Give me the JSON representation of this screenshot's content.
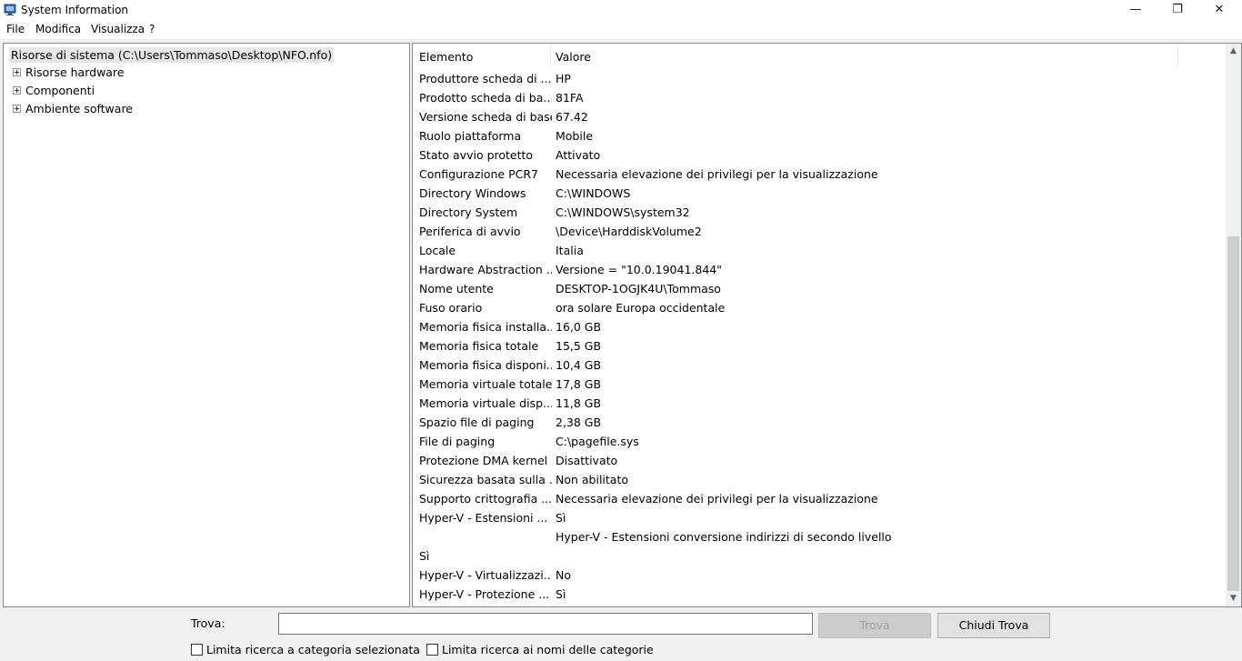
{
  "window": {
    "title": "System Information",
    "minimize_glyph": "—",
    "maximize_glyph": "❐",
    "close_glyph": "✕"
  },
  "menu": [
    "File",
    "Modifica",
    "Visualizza",
    "?"
  ],
  "tree": {
    "root": "Risorse di sistema (C:\\Users\\Tommaso\\Desktop\\NFO.nfo)",
    "items": [
      "Risorse hardware",
      "Componenti",
      "Ambiente software"
    ]
  },
  "table": {
    "headers": [
      "Elemento",
      "Valore"
    ],
    "rows": [
      {
        "e": "Produttore scheda di ...",
        "v": "HP"
      },
      {
        "e": "Prodotto scheda di ba...",
        "v": "81FA"
      },
      {
        "e": "Versione scheda di base",
        "v": "67.42"
      },
      {
        "e": "Ruolo piattaforma",
        "v": "Mobile"
      },
      {
        "e": "Stato avvio protetto",
        "v": "Attivato"
      },
      {
        "e": "Configurazione PCR7",
        "v": "Necessaria elevazione dei privilegi per la visualizzazione"
      },
      {
        "e": "Directory Windows",
        "v": "C:\\WINDOWS"
      },
      {
        "e": "Directory System",
        "v": "C:\\WINDOWS\\system32"
      },
      {
        "e": "Periferica di avvio",
        "v": "\\Device\\HarddiskVolume2"
      },
      {
        "e": "Locale",
        "v": "Italia"
      },
      {
        "e": "Hardware Abstraction ...",
        "v": "Versione = \"10.0.19041.844\""
      },
      {
        "e": "Nome utente",
        "v": "DESKTOP-1OGJK4U\\Tommaso"
      },
      {
        "e": "Fuso orario",
        "v": "ora solare Europa occidentale"
      },
      {
        "e": "Memoria fisica installa...",
        "v": "16,0 GB"
      },
      {
        "e": "Memoria fisica totale",
        "v": "15,5 GB"
      },
      {
        "e": "Memoria fisica disponi...",
        "v": "10,4 GB"
      },
      {
        "e": "Memoria virtuale totale",
        "v": "17,8 GB"
      },
      {
        "e": "Memoria virtuale disp...",
        "v": "11,8 GB"
      },
      {
        "e": "Spazio file di paging",
        "v": "2,38 GB"
      },
      {
        "e": "File di paging",
        "v": "C:\\pagefile.sys"
      },
      {
        "e": "Protezione DMA kernel",
        "v": "Disattivato"
      },
      {
        "e": "Sicurezza basata sulla ...",
        "v": "Non abilitato"
      },
      {
        "e": "Supporto crittografia ...",
        "v": "Necessaria elevazione dei privilegi per la visualizzazione"
      },
      {
        "e": "Hyper-V - Estensioni ...",
        "v": "Sì"
      },
      {
        "e": "",
        "v": "Hyper-V - Estensioni conversione indirizzi di secondo livello"
      },
      {
        "e": "Sì",
        "v": ""
      },
      {
        "e": "Hyper-V - Virtualizzazi...",
        "v": "No"
      },
      {
        "e": "Hyper-V - Protezione ...",
        "v": "Sì"
      }
    ]
  },
  "scrollbar": {
    "up_glyph": "▲",
    "down_glyph": "▼"
  },
  "find": {
    "label": "Trova:",
    "value": "",
    "find_button": "Trova",
    "close_button": "Chiudi Trova",
    "checkbox_category": "Limita ricerca a categoria selezionata",
    "checkbox_names": "Limita ricerca ai nomi delle categorie"
  }
}
